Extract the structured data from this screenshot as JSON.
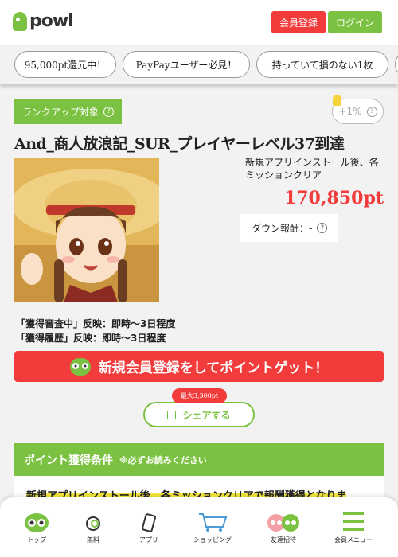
{
  "header": {
    "logo_text": "powl",
    "register_label": "会員登録",
    "login_label": "ログイン"
  },
  "filters": [
    "95,000pt還元中！",
    "PayPayユーザー必見！",
    "持っていて損のない1枚"
  ],
  "offer": {
    "rank_badge": "ランクアップ対象",
    "bonus_label": "+1%",
    "title": "And_商人放浪記_SUR_プレイヤーレベル37到達",
    "condition_short": "新規アプリインストール後、各ミッションクリア",
    "points": "170,850pt",
    "down_reward": "ダウン報酬：-",
    "note_review": "「獲得審査中」反映：即時～3日程度",
    "note_history": "「獲得履歴」反映：即時～3日程度"
  },
  "cta": {
    "label": "新規会員登録をしてポイントゲット！"
  },
  "share": {
    "tag": "最大3,300pt",
    "label": "シェアする"
  },
  "conditions": {
    "heading": "ポイント獲得条件",
    "note": "※必ずお読みください",
    "text": "新規アプリインストール後、各ミッションクリアで報酬獲得となりま"
  },
  "bottom_nav": [
    {
      "label": "トップ",
      "icon": "owl-icon"
    },
    {
      "label": "無料",
      "icon": "coin-icon"
    },
    {
      "label": "アプリ",
      "icon": "smartphone-icon"
    },
    {
      "label": "ショッピング",
      "icon": "cart-icon"
    },
    {
      "label": "友達招待",
      "icon": "friends-icon"
    },
    {
      "label": "会員メニュー",
      "icon": "menu-icon"
    }
  ],
  "colors": {
    "brand_green": "#7cc242",
    "accent_red": "#f23b3b",
    "highlight_yellow": "#f5e83b"
  }
}
